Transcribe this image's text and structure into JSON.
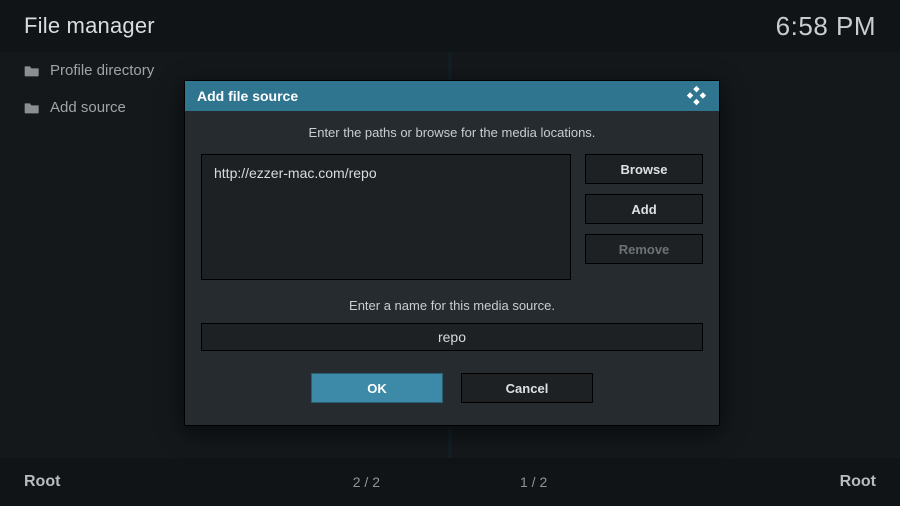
{
  "header": {
    "title": "File manager",
    "clock": "6:58 PM"
  },
  "left_panel": {
    "items": [
      {
        "label": "Profile directory"
      },
      {
        "label": "Add source"
      }
    ]
  },
  "footer": {
    "left_label": "Root",
    "counter_left": "2 / 2",
    "counter_right": "1 / 2",
    "right_label": "Root"
  },
  "dialog": {
    "title": "Add file source",
    "instruction_paths": "Enter the paths or browse for the media locations.",
    "path_value": "http://ezzer-mac.com/repo",
    "browse_label": "Browse",
    "add_label": "Add",
    "remove_label": "Remove",
    "instruction_name": "Enter a name for this media source.",
    "name_value": "repo",
    "ok_label": "OK",
    "cancel_label": "Cancel"
  }
}
